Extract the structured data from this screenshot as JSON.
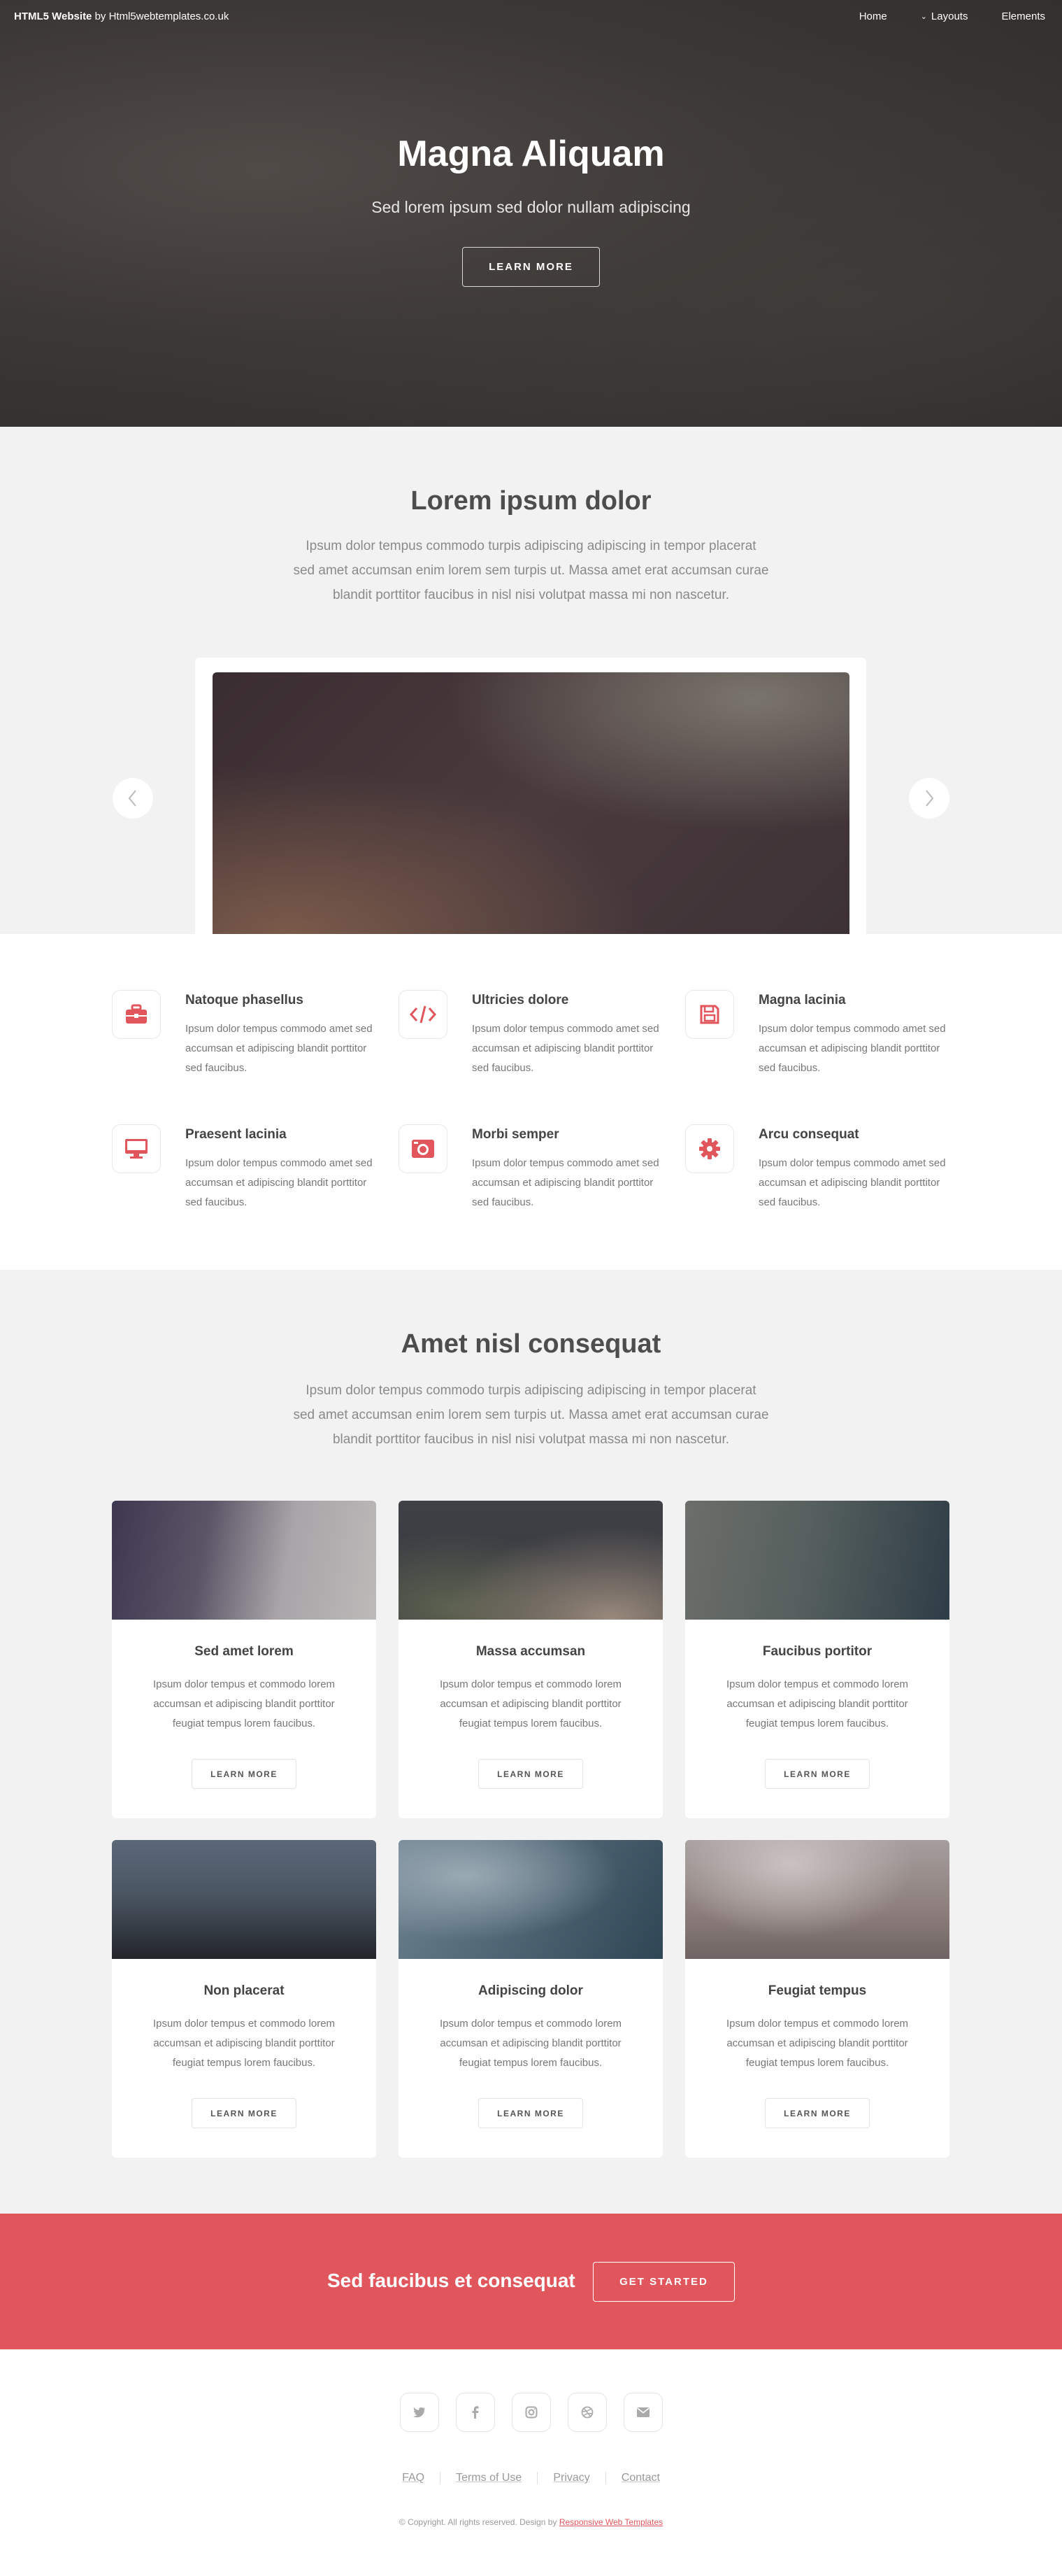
{
  "header": {
    "brand_bold": "HTML5 Website",
    "brand_rest": " by Html5webtemplates.co.uk",
    "nav": [
      "Home",
      "Layouts",
      "Elements"
    ]
  },
  "banner": {
    "title": "Magna Aliquam",
    "subtitle": "Sed lorem ipsum sed dolor nullam adipiscing",
    "button": "LEARN MORE"
  },
  "intro": {
    "title": "Lorem ipsum dolor",
    "text_lines": [
      "Ipsum dolor tempus commodo turpis adipiscing adipiscing in tempor placerat",
      "sed amet accumsan enim lorem sem turpis ut. Massa amet erat accumsan curae",
      "blandit porttitor faucibus in nisl nisi volutpat massa mi non nascetur."
    ]
  },
  "features": [
    {
      "icon": "briefcase-icon",
      "title": "Natoque phasellus"
    },
    {
      "icon": "code-icon",
      "title": "Ultricies dolore"
    },
    {
      "icon": "save-icon",
      "title": "Magna lacinia"
    },
    {
      "icon": "desktop-icon",
      "title": "Praesent lacinia"
    },
    {
      "icon": "camera-icon",
      "title": "Morbi semper"
    },
    {
      "icon": "cog-icon",
      "title": "Arcu consequat"
    }
  ],
  "feature_text": "Ipsum dolor tempus commodo amet sed accumsan et adipiscing blandit porttitor sed faucibus.",
  "cards_section": {
    "title": "Amet nisl consequat",
    "text_lines": [
      "Ipsum dolor tempus commodo turpis adipiscing adipiscing in tempor placerat",
      "sed amet accumsan enim lorem sem turpis ut. Massa amet erat accumsan curae",
      "blandit porttitor faucibus in nisl nisi volutpat massa mi non nascetur."
    ]
  },
  "cards": [
    {
      "title": "Sed amet lorem"
    },
    {
      "title": "Massa accumsan"
    },
    {
      "title": "Faucibus portitor"
    },
    {
      "title": "Non placerat"
    },
    {
      "title": "Adipiscing dolor"
    },
    {
      "title": "Feugiat tempus"
    }
  ],
  "card_text": "Ipsum dolor tempus et commodo lorem accumsan et adipiscing blandit porttitor feugiat tempus lorem faucibus.",
  "card_button": "LEARN MORE",
  "cta": {
    "text": "Sed faucibus et consequat",
    "button": "GET STARTED"
  },
  "footer": {
    "links": [
      "FAQ",
      "Terms of Use",
      "Privacy",
      "Contact"
    ],
    "copyright": "© Copyright. All rights reserved. Design by ",
    "credit": "Responsive Web Templates",
    "social": [
      "twitter-icon",
      "facebook-icon",
      "instagram-icon",
      "dribbble-icon",
      "envelope-icon"
    ]
  },
  "colors": {
    "accent": "#e0565c",
    "text": "#555555",
    "background": "#f2f2f2"
  }
}
